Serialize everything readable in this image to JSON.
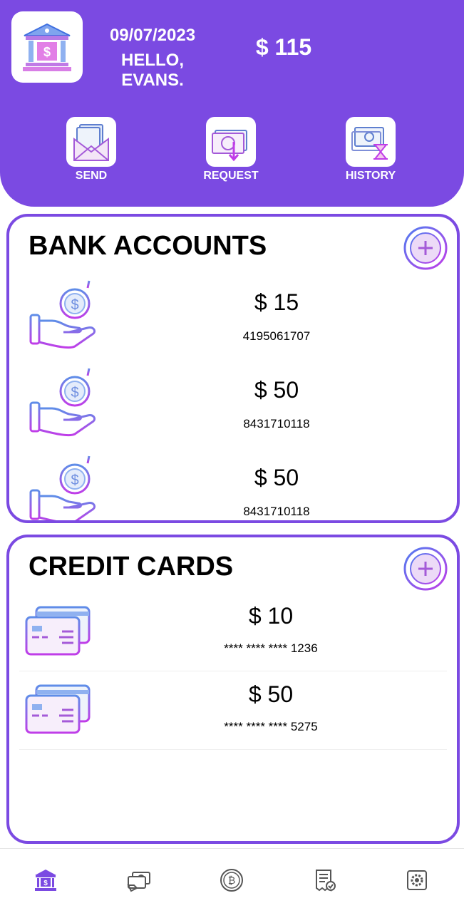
{
  "header": {
    "date": "09/07/2023",
    "greeting": "HELLO, EVANS.",
    "balance": "$ 115",
    "actions": [
      {
        "label": "SEND",
        "icon": "send-money-icon"
      },
      {
        "label": "REQUEST",
        "icon": "request-money-icon"
      },
      {
        "label": "HISTORY",
        "icon": "history-icon"
      }
    ]
  },
  "bank_accounts": {
    "title": "BANK ACCOUNTS",
    "add_icon": "plus-circle-icon",
    "items": [
      {
        "amount": "$ 15",
        "number": "4195061707"
      },
      {
        "amount": "$ 50",
        "number": "8431710118"
      },
      {
        "amount": "$ 50",
        "number": "8431710118"
      }
    ]
  },
  "credit_cards": {
    "title": "CREDIT CARDS",
    "add_icon": "plus-circle-icon",
    "items": [
      {
        "amount": "$ 10",
        "number": "**** **** **** 1236"
      },
      {
        "amount": "$ 50",
        "number": "**** **** **** 5275"
      }
    ]
  },
  "bottom_nav": [
    {
      "icon": "bank-icon",
      "active": true
    },
    {
      "icon": "money-transfer-icon",
      "active": false
    },
    {
      "icon": "bitcoin-icon",
      "active": false
    },
    {
      "icon": "receipt-icon",
      "active": false
    },
    {
      "icon": "settings-icon",
      "active": false
    }
  ],
  "colors": {
    "accent": "#7b4ae2",
    "icon_gradient_start": "#4f7df0",
    "icon_gradient_end": "#c03de8"
  }
}
